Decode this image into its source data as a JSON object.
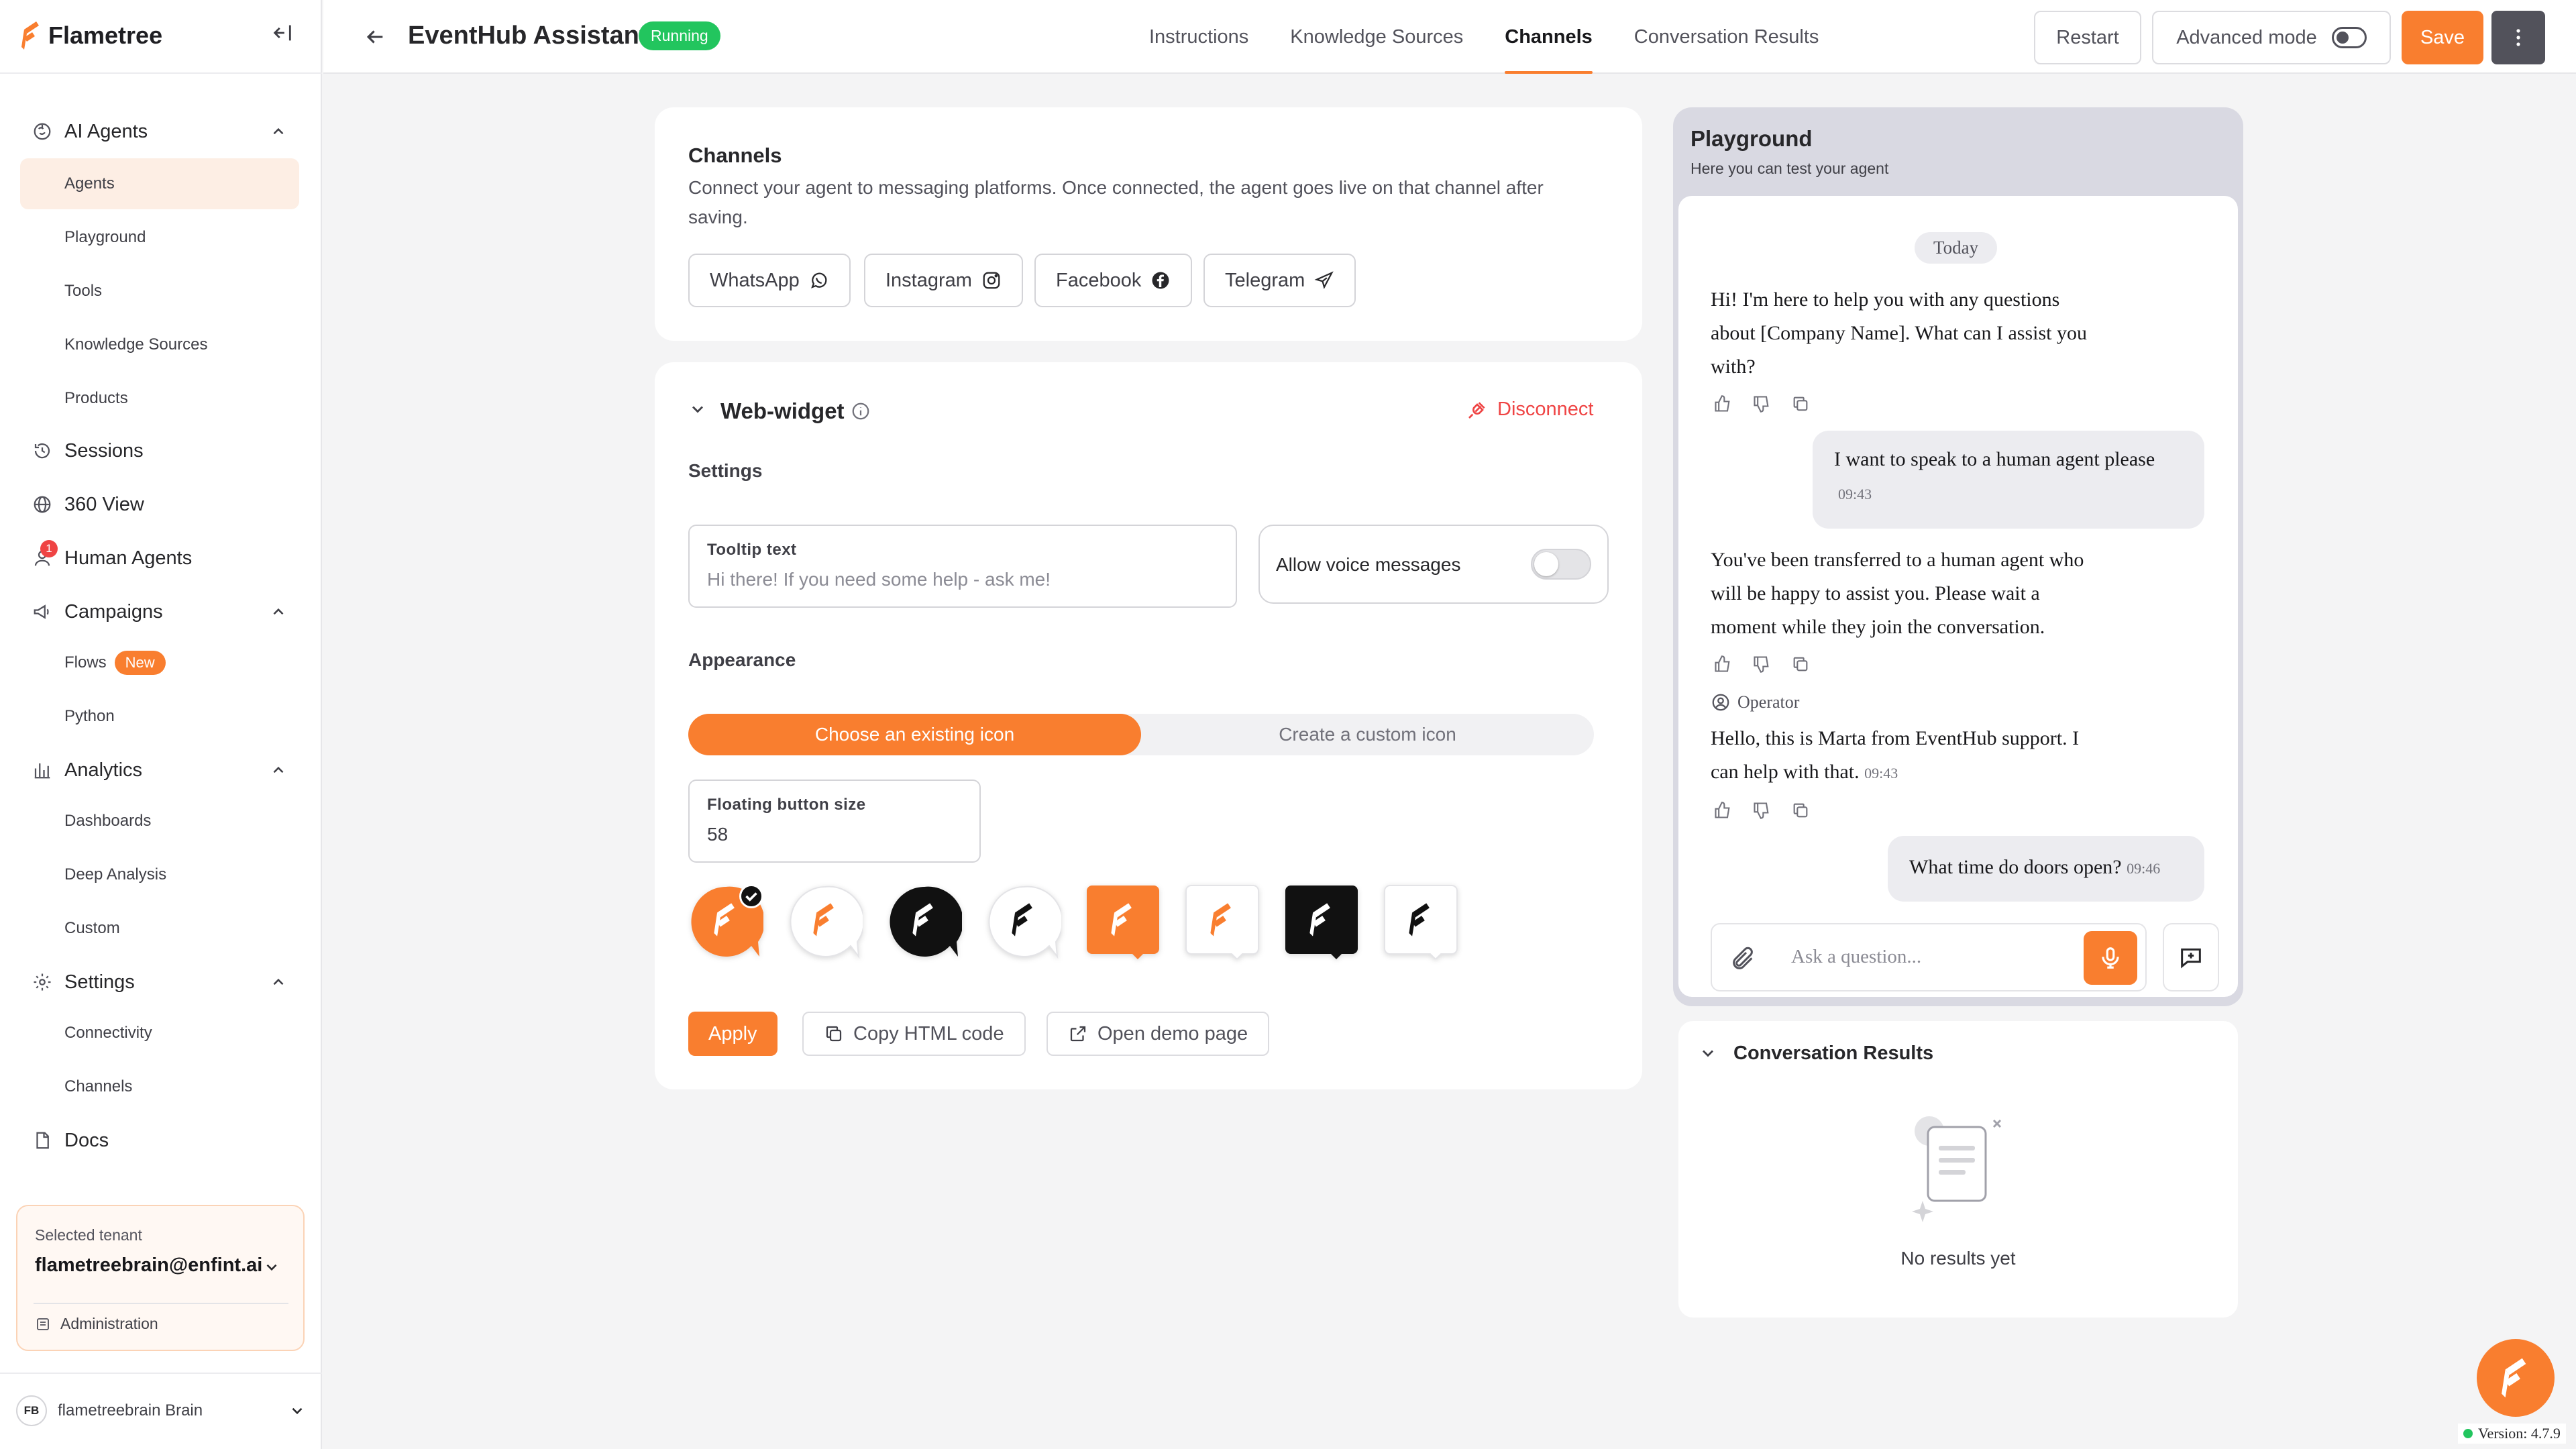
{
  "brand": {
    "name": "Flametree"
  },
  "sidebar": {
    "sections": [
      {
        "label": "AI Agents",
        "icon": "brain-icon"
      },
      {
        "label": "Sessions",
        "icon": "history-icon"
      },
      {
        "label": "360 View",
        "icon": "view-360-icon"
      },
      {
        "label": "Human Agents",
        "icon": "person-icon",
        "badge": "1"
      },
      {
        "label": "Campaigns",
        "icon": "megaphone-icon"
      },
      {
        "label": "Analytics",
        "icon": "bar-chart-icon"
      },
      {
        "label": "Settings",
        "icon": "gear-icon"
      },
      {
        "label": "Docs",
        "icon": "docs-icon"
      }
    ],
    "ai_agents_items": [
      "Agents",
      "Playground",
      "Tools",
      "Knowledge Sources",
      "Products"
    ],
    "campaigns_items": [
      "Flows",
      "Python"
    ],
    "flows_badge": "New",
    "analytics_items": [
      "Dashboards",
      "Deep Analysis",
      "Custom"
    ],
    "settings_items": [
      "Connectivity",
      "Channels"
    ],
    "active_item": "Agents",
    "tenant": {
      "label": "Selected tenant",
      "email": "flametreebrain@enfint.ai",
      "admin": "Administration"
    },
    "user": {
      "initials": "FB",
      "name": "flametreebrain Brain"
    }
  },
  "header": {
    "title": "EventHub Assistant",
    "status": "Running",
    "tabs": [
      "Instructions",
      "Knowledge Sources",
      "Channels",
      "Conversation Results"
    ],
    "active_tab": "Channels",
    "restart": "Restart",
    "advanced_mode": "Advanced mode",
    "save": "Save"
  },
  "channels": {
    "title": "Channels",
    "description": "Connect your agent to messaging platforms. Once connected, the agent goes live on that channel after saving.",
    "buttons": [
      {
        "label": "WhatsApp",
        "icon": "whatsapp-icon"
      },
      {
        "label": "Instagram",
        "icon": "instagram-icon"
      },
      {
        "label": "Facebook",
        "icon": "facebook-icon"
      },
      {
        "label": "Telegram",
        "icon": "telegram-icon"
      }
    ]
  },
  "widget": {
    "title": "Web-widget",
    "disconnect": "Disconnect",
    "settings_label": "Settings",
    "tooltip_label": "Tooltip text",
    "tooltip_placeholder": "Hi there! If you need some help - ask me!",
    "voice_label": "Allow voice messages",
    "voice_enabled": false,
    "appearance_label": "Appearance",
    "segment": [
      "Choose an existing icon",
      "Create a custom icon"
    ],
    "segment_active": 0,
    "size_label": "Floating button size",
    "size_value": "58",
    "icon_options": [
      {
        "shape": "bubble",
        "bg": "#f97e2f",
        "fg": "#ffffff",
        "selected": true
      },
      {
        "shape": "bubble",
        "bg": "#ffffff",
        "fg": "#f97e2f"
      },
      {
        "shape": "bubble",
        "bg": "#111111",
        "fg": "#ffffff"
      },
      {
        "shape": "bubble",
        "bg": "#ffffff",
        "fg": "#111111"
      },
      {
        "shape": "square",
        "bg": "#f97e2f",
        "fg": "#ffffff"
      },
      {
        "shape": "square",
        "bg": "#ffffff",
        "fg": "#f97e2f"
      },
      {
        "shape": "square",
        "bg": "#111111",
        "fg": "#ffffff"
      },
      {
        "shape": "square",
        "bg": "#ffffff",
        "fg": "#111111"
      }
    ],
    "apply": "Apply",
    "copy_html": "Copy HTML code",
    "open_demo": "Open demo page"
  },
  "playground": {
    "title": "Playground",
    "subtitle": "Here you can test your agent",
    "date": "Today",
    "messages": [
      {
        "from": "bot",
        "lines": [
          "Hi! I'm here to help you with any questions",
          "about [Company Name]. What can I assist you",
          "with?"
        ]
      },
      {
        "from": "user",
        "text": "I want to speak to a human agent please",
        "time": "09:43"
      },
      {
        "from": "bot",
        "lines": [
          "You've been transferred to a human agent who",
          "will be happy to assist you. Please wait a",
          "moment while they join the conversation."
        ]
      },
      {
        "from": "operator",
        "label": "Operator",
        "lines": [
          "Hello, this is Marta from EventHub support. I",
          "can help with that."
        ],
        "time": "09:43"
      },
      {
        "from": "user",
        "text": "What time do doors open?",
        "time": "09:46"
      }
    ],
    "input_placeholder": "Ask a question..."
  },
  "results": {
    "title": "Conversation Results",
    "empty": "No results yet"
  },
  "version": "Version: 4.7.9",
  "colors": {
    "accent": "#f97e2f",
    "running": "#22c55e",
    "danger": "#ef4444"
  }
}
